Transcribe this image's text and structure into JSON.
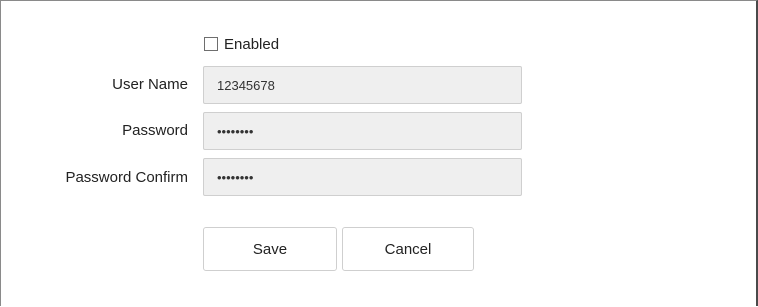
{
  "form": {
    "enabled": {
      "label": "Enabled",
      "checked": false
    },
    "username": {
      "label": "User Name",
      "value": "12345678"
    },
    "password": {
      "label": "Password",
      "value": "••••••••"
    },
    "password_confirm": {
      "label": "Password Confirm",
      "value": "••••••••"
    }
  },
  "buttons": {
    "save_label": "Save",
    "cancel_label": "Cancel"
  }
}
